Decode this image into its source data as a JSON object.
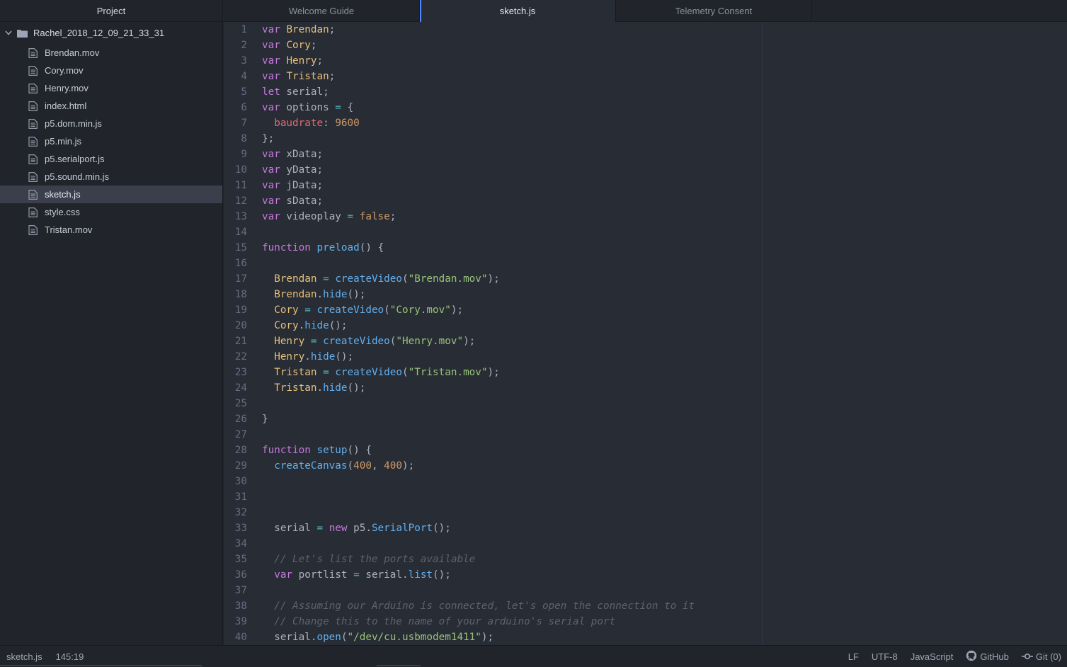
{
  "sidebar": {
    "title": "Project",
    "root_folder": "Rachel_2018_12_09_21_33_31",
    "files": [
      {
        "name": "Brendan.mov",
        "selected": false
      },
      {
        "name": "Cory.mov",
        "selected": false
      },
      {
        "name": "Henry.mov",
        "selected": false
      },
      {
        "name": "index.html",
        "selected": false
      },
      {
        "name": "p5.dom.min.js",
        "selected": false
      },
      {
        "name": "p5.min.js",
        "selected": false
      },
      {
        "name": "p5.serialport.js",
        "selected": false
      },
      {
        "name": "p5.sound.min.js",
        "selected": false
      },
      {
        "name": "sketch.js",
        "selected": true
      },
      {
        "name": "style.css",
        "selected": false
      },
      {
        "name": "Tristan.mov",
        "selected": false
      }
    ]
  },
  "tabs": [
    {
      "label": "Welcome Guide",
      "active": false
    },
    {
      "label": "sketch.js",
      "active": true
    },
    {
      "label": "Telemetry Consent",
      "active": false
    }
  ],
  "editor": {
    "lines": [
      [
        [
          "kw",
          "var"
        ],
        [
          "pun",
          " "
        ],
        [
          "var",
          "Brendan"
        ],
        [
          "pun",
          ";"
        ]
      ],
      [
        [
          "kw",
          "var"
        ],
        [
          "pun",
          " "
        ],
        [
          "var",
          "Cory"
        ],
        [
          "pun",
          ";"
        ]
      ],
      [
        [
          "kw",
          "var"
        ],
        [
          "pun",
          " "
        ],
        [
          "var",
          "Henry"
        ],
        [
          "pun",
          ";"
        ]
      ],
      [
        [
          "kw",
          "var"
        ],
        [
          "pun",
          " "
        ],
        [
          "var",
          "Tristan"
        ],
        [
          "pun",
          ";"
        ]
      ],
      [
        [
          "kw",
          "let"
        ],
        [
          "pun",
          " serial;"
        ]
      ],
      [
        [
          "kw",
          "var"
        ],
        [
          "pun",
          " options "
        ],
        [
          "op",
          "="
        ],
        [
          "pun",
          " {"
        ]
      ],
      [
        [
          "pun",
          "  "
        ],
        [
          "prop",
          "baudrate"
        ],
        [
          "pun",
          ": "
        ],
        [
          "num",
          "9600"
        ]
      ],
      [
        [
          "pun",
          "};"
        ]
      ],
      [
        [
          "kw",
          "var"
        ],
        [
          "pun",
          " xData;"
        ]
      ],
      [
        [
          "kw",
          "var"
        ],
        [
          "pun",
          " yData;"
        ]
      ],
      [
        [
          "kw",
          "var"
        ],
        [
          "pun",
          " jData;"
        ]
      ],
      [
        [
          "kw",
          "var"
        ],
        [
          "pun",
          " sData;"
        ]
      ],
      [
        [
          "kw",
          "var"
        ],
        [
          "pun",
          " videoplay "
        ],
        [
          "op",
          "="
        ],
        [
          "pun",
          " "
        ],
        [
          "num",
          "false"
        ],
        [
          "pun",
          ";"
        ]
      ],
      [],
      [
        [
          "kw",
          "function"
        ],
        [
          "pun",
          " "
        ],
        [
          "fn",
          "preload"
        ],
        [
          "pun",
          "() {"
        ]
      ],
      [],
      [
        [
          "pun",
          "  "
        ],
        [
          "var",
          "Brendan"
        ],
        [
          "pun",
          " "
        ],
        [
          "op",
          "="
        ],
        [
          "pun",
          " "
        ],
        [
          "fn",
          "createVideo"
        ],
        [
          "pun",
          "("
        ],
        [
          "str",
          "\"Brendan.mov\""
        ],
        [
          "pun",
          ");"
        ]
      ],
      [
        [
          "pun",
          "  "
        ],
        [
          "var",
          "Brendan"
        ],
        [
          "pun",
          "."
        ],
        [
          "fn",
          "hide"
        ],
        [
          "pun",
          "();"
        ]
      ],
      [
        [
          "pun",
          "  "
        ],
        [
          "var",
          "Cory"
        ],
        [
          "pun",
          " "
        ],
        [
          "op",
          "="
        ],
        [
          "pun",
          " "
        ],
        [
          "fn",
          "createVideo"
        ],
        [
          "pun",
          "("
        ],
        [
          "str",
          "\"Cory.mov\""
        ],
        [
          "pun",
          ");"
        ]
      ],
      [
        [
          "pun",
          "  "
        ],
        [
          "var",
          "Cory"
        ],
        [
          "pun",
          "."
        ],
        [
          "fn",
          "hide"
        ],
        [
          "pun",
          "();"
        ]
      ],
      [
        [
          "pun",
          "  "
        ],
        [
          "var",
          "Henry"
        ],
        [
          "pun",
          " "
        ],
        [
          "op",
          "="
        ],
        [
          "pun",
          " "
        ],
        [
          "fn",
          "createVideo"
        ],
        [
          "pun",
          "("
        ],
        [
          "str",
          "\"Henry.mov\""
        ],
        [
          "pun",
          ");"
        ]
      ],
      [
        [
          "pun",
          "  "
        ],
        [
          "var",
          "Henry"
        ],
        [
          "pun",
          "."
        ],
        [
          "fn",
          "hide"
        ],
        [
          "pun",
          "();"
        ]
      ],
      [
        [
          "pun",
          "  "
        ],
        [
          "var",
          "Tristan"
        ],
        [
          "pun",
          " "
        ],
        [
          "op",
          "="
        ],
        [
          "pun",
          " "
        ],
        [
          "fn",
          "createVideo"
        ],
        [
          "pun",
          "("
        ],
        [
          "str",
          "\"Tristan.mov\""
        ],
        [
          "pun",
          ");"
        ]
      ],
      [
        [
          "pun",
          "  "
        ],
        [
          "var",
          "Tristan"
        ],
        [
          "pun",
          "."
        ],
        [
          "fn",
          "hide"
        ],
        [
          "pun",
          "();"
        ]
      ],
      [],
      [
        [
          "pun",
          "}"
        ]
      ],
      [],
      [
        [
          "kw",
          "function"
        ],
        [
          "pun",
          " "
        ],
        [
          "fn",
          "setup"
        ],
        [
          "pun",
          "() {"
        ]
      ],
      [
        [
          "pun",
          "  "
        ],
        [
          "fn",
          "createCanvas"
        ],
        [
          "pun",
          "("
        ],
        [
          "num",
          "400"
        ],
        [
          "pun",
          ", "
        ],
        [
          "num",
          "400"
        ],
        [
          "pun",
          ");"
        ]
      ],
      [],
      [],
      [],
      [
        [
          "pun",
          "  serial "
        ],
        [
          "op",
          "="
        ],
        [
          "pun",
          " "
        ],
        [
          "kw",
          "new"
        ],
        [
          "pun",
          " p5."
        ],
        [
          "fn",
          "SerialPort"
        ],
        [
          "pun",
          "();"
        ]
      ],
      [],
      [
        [
          "pun",
          "  "
        ],
        [
          "cmt",
          "// Let's list the ports available"
        ]
      ],
      [
        [
          "pun",
          "  "
        ],
        [
          "kw",
          "var"
        ],
        [
          "pun",
          " portlist "
        ],
        [
          "op",
          "="
        ],
        [
          "pun",
          " serial."
        ],
        [
          "fn",
          "list"
        ],
        [
          "pun",
          "();"
        ]
      ],
      [],
      [
        [
          "pun",
          "  "
        ],
        [
          "cmt",
          "// Assuming our Arduino is connected, let's open the connection to it"
        ]
      ],
      [
        [
          "pun",
          "  "
        ],
        [
          "cmt",
          "// Change this to the name of your arduino's serial port"
        ]
      ],
      [
        [
          "pun",
          "  serial."
        ],
        [
          "fn",
          "open"
        ],
        [
          "pun",
          "("
        ],
        [
          "str",
          "\"/dev/cu.usbmodem1411\""
        ],
        [
          "pun",
          ");"
        ]
      ]
    ]
  },
  "status": {
    "file": "sketch.js",
    "cursor": "145:19",
    "line_ending": "LF",
    "encoding": "UTF-8",
    "grammar": "JavaScript",
    "github": "GitHub",
    "git": "Git (0)"
  }
}
